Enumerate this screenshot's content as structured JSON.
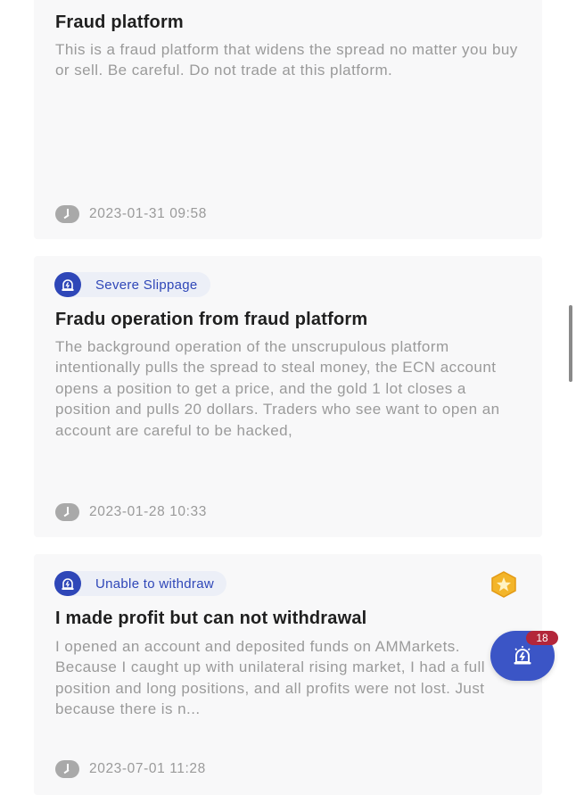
{
  "cards": [
    {
      "title": "Fraud platform",
      "body": "This is a fraud platform that widens the spread no matter you buy or sell. Be careful. Do not trade at this platform.",
      "time": "2023-01-31 09:58"
    },
    {
      "tag": "Severe Slippage",
      "title": "Fradu operation from fraud platform",
      "body": "The background operation of the unscrupulous platform intentionally pulls the spread to steal money, the ECN account opens a position to get a price, and the gold 1 lot closes a position and pulls 20 dollars. Traders who see want to open an account are careful to be hacked,",
      "time": "2023-01-28 10:33"
    },
    {
      "tag": "Unable to withdraw",
      "title": "I made profit but can not withdrawal",
      "body": "I opened an account and deposited funds on AMMarkets. Because I caught up with unilateral rising market, I had a full position and long positions, and all profits were not lost. Just because there is n...",
      "time": "2023-07-01 11:28"
    }
  ],
  "fab": {
    "badge": "18",
    "icon": "alarm-icon"
  },
  "colors": {
    "accent": "#2f47b8",
    "badge": "#b3263a",
    "card_bg": "#f8f8f9",
    "medal": "#f3b52a"
  }
}
